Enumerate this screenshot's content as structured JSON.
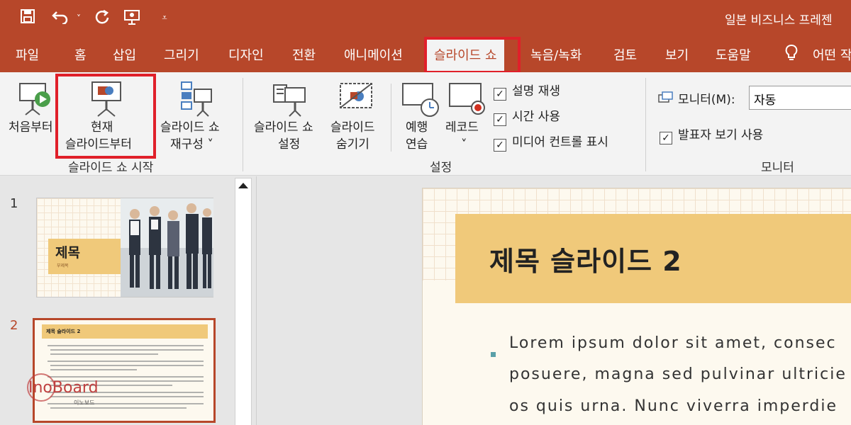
{
  "window": {
    "title": "일본 비즈니스 프레젠",
    "qat": [
      "save-icon",
      "undo-icon",
      "redo-icon",
      "present-icon",
      "customize-icon"
    ]
  },
  "tabs": [
    {
      "label": "파일"
    },
    {
      "label": "홈"
    },
    {
      "label": "삽입"
    },
    {
      "label": "그리기"
    },
    {
      "label": "디자인"
    },
    {
      "label": "전환"
    },
    {
      "label": "애니메이션"
    },
    {
      "label": "슬라이드 쇼",
      "active": true
    },
    {
      "label": "녹음/녹화"
    },
    {
      "label": "검토"
    },
    {
      "label": "보기"
    },
    {
      "label": "도움말"
    },
    {
      "label": "어떤 작"
    }
  ],
  "ribbon": {
    "start_group": {
      "from_beginning": "처음부터",
      "from_current_line1": "현재",
      "from_current_line2": "슬라이드부터",
      "custom_line1": "슬라이드 쇼",
      "custom_line2": "재구성 ˅",
      "label": "슬라이드 쇼 시작"
    },
    "setup_group": {
      "setup_line1": "슬라이드 쇼",
      "setup_line2": "설정",
      "hide_line1": "슬라이드",
      "hide_line2": "숨기기",
      "rehearse_line1": "예행",
      "rehearse_line2": "연습",
      "record_line1": "레코드",
      "record_line2": "˅",
      "check_narration": "설명 재생",
      "check_timings": "시간 사용",
      "check_media": "미디어 컨트롤 표시",
      "label": "설정"
    },
    "monitor_group": {
      "monitor_label": "모니터(M):",
      "monitor_value": "자동",
      "presenter_view": "발표자 보기 사용",
      "label": "모니터"
    }
  },
  "slides_pane": {
    "slide1_num": "1",
    "slide1_title": "제목",
    "slide1_subtitle": "부제목",
    "slide2_num": "2",
    "slide2_title": "제목 슬라이드 2"
  },
  "current_slide": {
    "title": "제목 슬라이드 2",
    "line1": "Lorem ipsum dolor sit amet, consec",
    "line2": "posuere, magna sed pulvinar ultricie",
    "line3": "os quis urna. Nunc viverra imperdie"
  },
  "watermark": {
    "brand": "InoBoard",
    "sub": "이노보드"
  },
  "colors": {
    "accent": "#b7472a",
    "highlight": "#e0202a",
    "title_band": "#f0c97a"
  }
}
